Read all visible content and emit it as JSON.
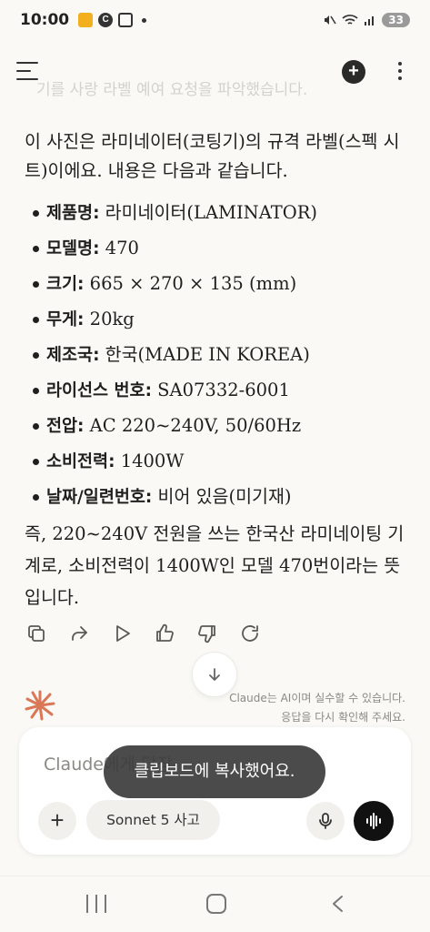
{
  "status_bar": {
    "time": "10:00",
    "notification_c": "C",
    "battery": "33"
  },
  "header": {
    "faded_text": "기를 사랑 라벨 예여 요청을 파악했습니다.",
    "new_chat_icon": "plus-circle-icon",
    "more_icon": "more-vertical-icon",
    "menu_icon": "menu-icon"
  },
  "message": {
    "intro": "이 사진은 라미네이터(코팅기)의 규격 라벨(스펙 시트)이에요. 내용은 다음과 같습니다.",
    "specs": [
      {
        "key": "제품명",
        "value": "라미네이터(LAMINATOR)"
      },
      {
        "key": "모델명",
        "value": "470"
      },
      {
        "key": "크기",
        "value": "665 × 270 × 135 (mm)"
      },
      {
        "key": "무게",
        "value": "20kg"
      },
      {
        "key": "제조국",
        "value": "한국(MADE IN KOREA)"
      },
      {
        "key": "라이선스 번호",
        "value": "SA07332-6001"
      },
      {
        "key": "전압",
        "value": "AC 220~240V, 50/60Hz"
      },
      {
        "key": "소비전력",
        "value": "1400W"
      },
      {
        "key": "날짜/일련번호",
        "value": "비어 있음(미기재)"
      }
    ],
    "key_suffix": ":",
    "summary": "즉, 220~240V 전원을 쓰는 한국산 라미네이팅 기계로, 소비전력이 1400W인 모델 470번이라는 뜻입니다."
  },
  "actions": [
    "copy-icon",
    "share-icon",
    "play-icon",
    "thumbs-up-icon",
    "thumbs-down-icon",
    "retry-icon"
  ],
  "disclaimer": {
    "line1": "Claude는 AI이며 실수할 수 있습니다.",
    "line2": "응답을 다시 확인해 주세요."
  },
  "composer": {
    "placeholder": "Claude에게 답장",
    "add_label": "+",
    "model_label": "Sonnet 5 사고"
  },
  "toast": {
    "text": "클립보드에 복사했어요."
  },
  "colors": {
    "background": "#faf9f5",
    "claude_orange": "#d97757",
    "text": "#1f1f1d"
  }
}
